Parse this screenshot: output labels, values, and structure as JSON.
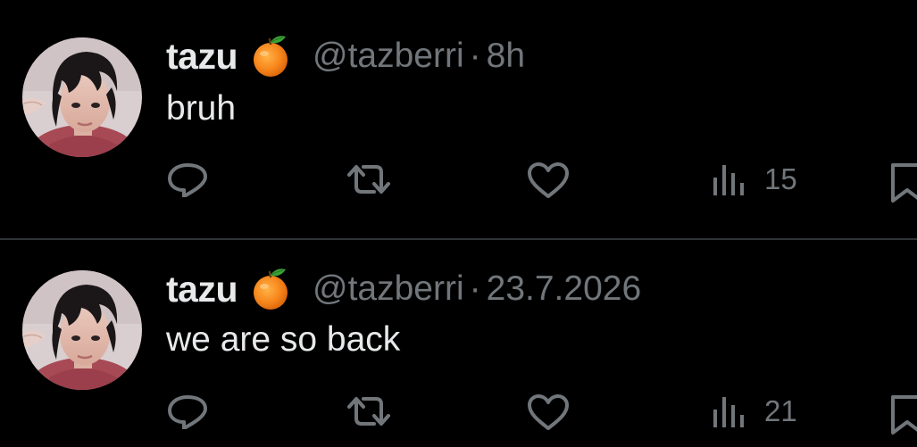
{
  "tweets": [
    {
      "display_name": "tazu",
      "name_emoji": "tangerine-emoji",
      "handle": "@tazberri",
      "separator": "·",
      "time": "8h",
      "text": "bruh",
      "views": "15"
    },
    {
      "display_name": "tazu",
      "name_emoji": "tangerine-emoji",
      "handle": "@tazberri",
      "separator": "·",
      "time": "23.7.2026",
      "text": "we are so back",
      "views": "21"
    }
  ],
  "actions": [
    "reply-icon",
    "retweet-icon",
    "like-icon",
    "views-icon",
    "bookmark-icon"
  ],
  "colors": {
    "background": "#000000",
    "primary_text": "#e7e9ea",
    "secondary_text": "#71767b",
    "divider": "#2f3336"
  }
}
